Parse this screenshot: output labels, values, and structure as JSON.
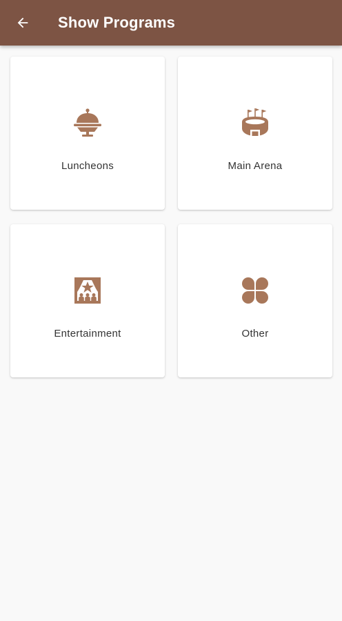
{
  "colors": {
    "app_bar": "#7d5444",
    "icon": "#a8775a",
    "background": "#f9f9f9",
    "card": "#ffffff"
  },
  "app_bar": {
    "title": "Show Programs",
    "back_icon": "arrow-left-icon"
  },
  "programs": [
    {
      "label": "Luncheons",
      "icon": "cloche-icon"
    },
    {
      "label": "Main Arena",
      "icon": "arena-icon"
    },
    {
      "label": "Entertainment",
      "icon": "stage-icon"
    },
    {
      "label": "Other",
      "icon": "clover-icon"
    }
  ]
}
